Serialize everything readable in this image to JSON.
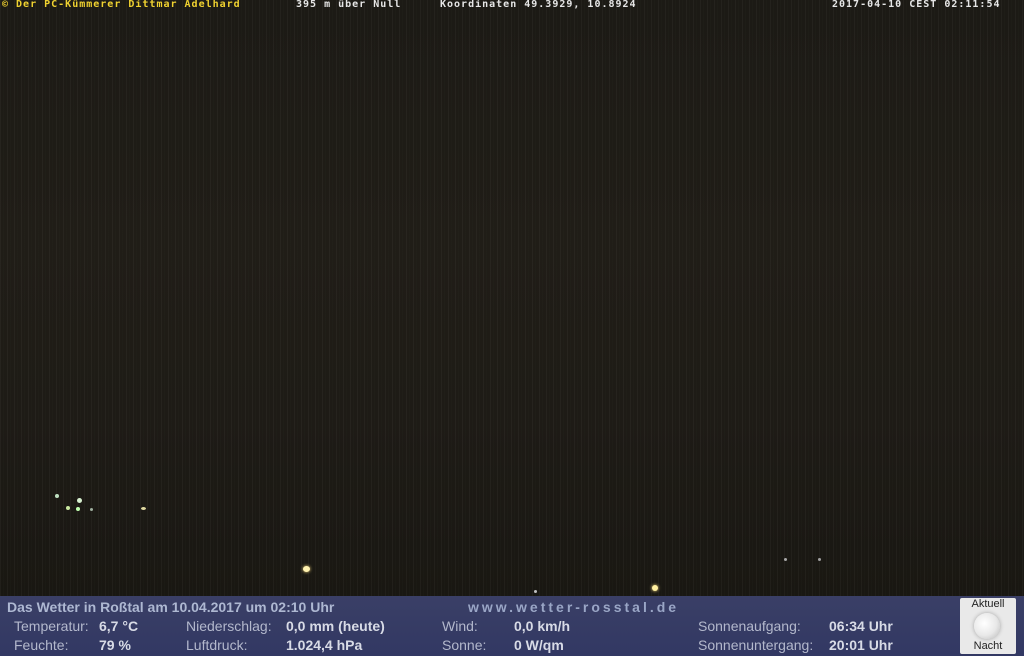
{
  "camera": {
    "caption_left": "© Der PC-Kümmerer Dittmar Adelhard",
    "caption_alt": "395 m über Null",
    "caption_coords": "Koordinaten 49.3929, 10.8924",
    "caption_time": "2017-04-10 CEST 02:11:54"
  },
  "weather": {
    "headline": "Das Wetter in Roßtal am 10.04.2017 um 02:10 Uhr",
    "site": "www.wetter-rosstal.de",
    "temperature_label": "Temperatur:",
    "temperature_value": "6,7 °C",
    "humidity_label": "Feuchte:",
    "humidity_value": "79 %",
    "precip_label": "Niederschlag:",
    "precip_value": "0,0 mm (heute)",
    "pressure_label": "Luftdruck:",
    "pressure_value": "1.024,4 hPa",
    "wind_label": "Wind:",
    "wind_value": "0,0 km/h",
    "sun_label": "Sonne:",
    "sun_value": "0 W/qm",
    "sunrise_label": "Sonnenaufgang:",
    "sunrise_value": "06:34 Uhr",
    "sunset_label": "Sonnenuntergang:",
    "sunset_value": "20:01 Uhr"
  },
  "moon": {
    "top_label": "Aktuell",
    "bottom_label": "Nacht",
    "icon": "moon-icon"
  }
}
